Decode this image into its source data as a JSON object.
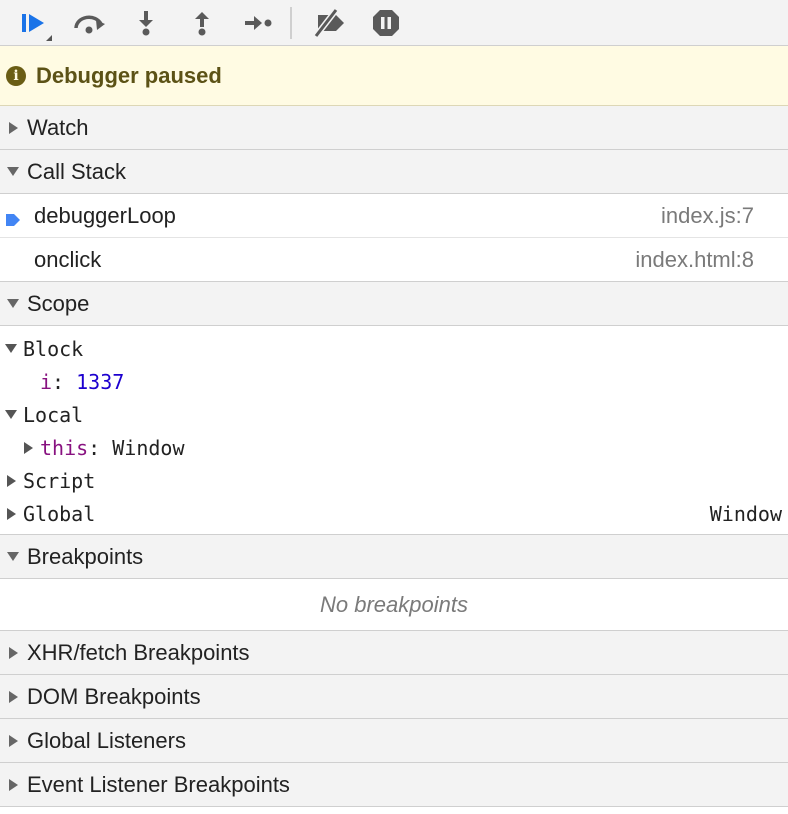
{
  "toolbar": {
    "buttons": [
      {
        "icon": "resume-icon"
      },
      {
        "icon": "step-over-icon"
      },
      {
        "icon": "step-into-icon"
      },
      {
        "icon": "step-out-icon"
      },
      {
        "icon": "step-icon"
      },
      {
        "icon": "deactivate-breakpoints-icon"
      },
      {
        "icon": "pause-on-exceptions-icon"
      }
    ]
  },
  "status": {
    "text": "Debugger paused",
    "icon": "info-icon",
    "color": "#fffbe3"
  },
  "sections": {
    "watch": "Watch",
    "call_stack": "Call Stack",
    "scope": "Scope",
    "breakpoints": "Breakpoints",
    "xhr": "XHR/fetch Breakpoints",
    "dom": "DOM Breakpoints",
    "global_listeners": "Global Listeners",
    "event_listener": "Event Listener Breakpoints"
  },
  "call_stack": [
    {
      "name": "debuggerLoop",
      "location": "index.js:7"
    },
    {
      "name": "onclick",
      "location": "index.html:8"
    }
  ],
  "scope": {
    "block": {
      "label": "Block",
      "var_name": "i",
      "var_value": "1337"
    },
    "local": {
      "label": "Local",
      "var_name": "this",
      "var_value": "Window"
    },
    "script": {
      "label": "Script"
    },
    "global": {
      "label": "Global",
      "value": "Window"
    }
  },
  "breakpoints": {
    "empty_text": "No breakpoints"
  },
  "colors": {
    "accent": "#4285f4",
    "prop": "#881280",
    "number": "#1c00cf"
  }
}
